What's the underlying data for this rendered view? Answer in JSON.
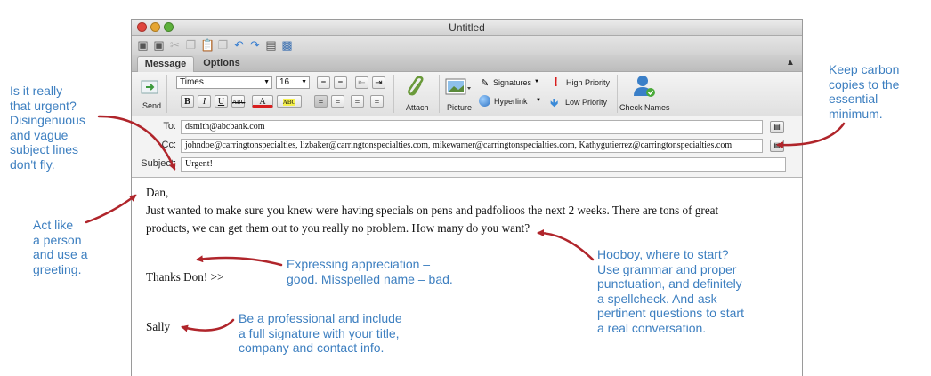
{
  "window": {
    "title": "Untitled",
    "tabs": [
      "Message",
      "Options"
    ]
  },
  "ribbon": {
    "send_label": "Send",
    "font_name": "Times",
    "font_size": "16",
    "bold": "B",
    "italic": "I",
    "underline": "U",
    "strike": "ABC",
    "font_color": "A",
    "highlight": "ABC",
    "attach_label": "Attach",
    "picture_label": "Picture",
    "signatures_label": "Signatures",
    "hyperlink_label": "Hyperlink",
    "high_priority_label": "High Priority",
    "low_priority_label": "Low Priority",
    "check_names_label": "Check Names"
  },
  "header": {
    "to_label": "To:",
    "to_value": "dsmith@abcbank.com",
    "cc_label": "Cc:",
    "cc_value": "johndoe@carringtonspecialties, lizbaker@carringtonspecialties.com, mikewarner@carringtonspecialties.com, Kathygutierrez@carringtonspecialties.com",
    "subject_label": "Subject:",
    "subject_value": "Urgent!"
  },
  "body": {
    "greeting": "Dan,",
    "line1": "Just wanted to make sure you knew were having specials on pens and padfolioos the next 2 weeks. There are tons of great",
    "line2": "products, we can get them out to you really no problem. How many do you want?",
    "thanks": "Thanks Don! >>",
    "signature": "Sally"
  },
  "annotations": {
    "urgent": [
      "Is it really",
      "that urgent?",
      "Disingenuous",
      "and vague",
      "subject lines",
      "don't fly."
    ],
    "greeting": [
      "Act like",
      "a person",
      "and use a",
      "greeting."
    ],
    "carbon": [
      "Keep carbon",
      "copies to the",
      "essential",
      "minimum."
    ],
    "appreciation": [
      "Expressing appreciation –",
      "good. Misspelled name – bad."
    ],
    "professional": [
      "Be a professional and include",
      "a full signature with your title,",
      "company and contact info."
    ],
    "hooboy": [
      "Hooboy, where to start?",
      "Use grammar and proper",
      "punctuation, and definitely",
      "a spellcheck. And ask",
      "pertinent questions to start",
      "a real conversation."
    ]
  },
  "colors": {
    "annotation_text": "#3d7fc0",
    "arrow": "#b0252b"
  }
}
